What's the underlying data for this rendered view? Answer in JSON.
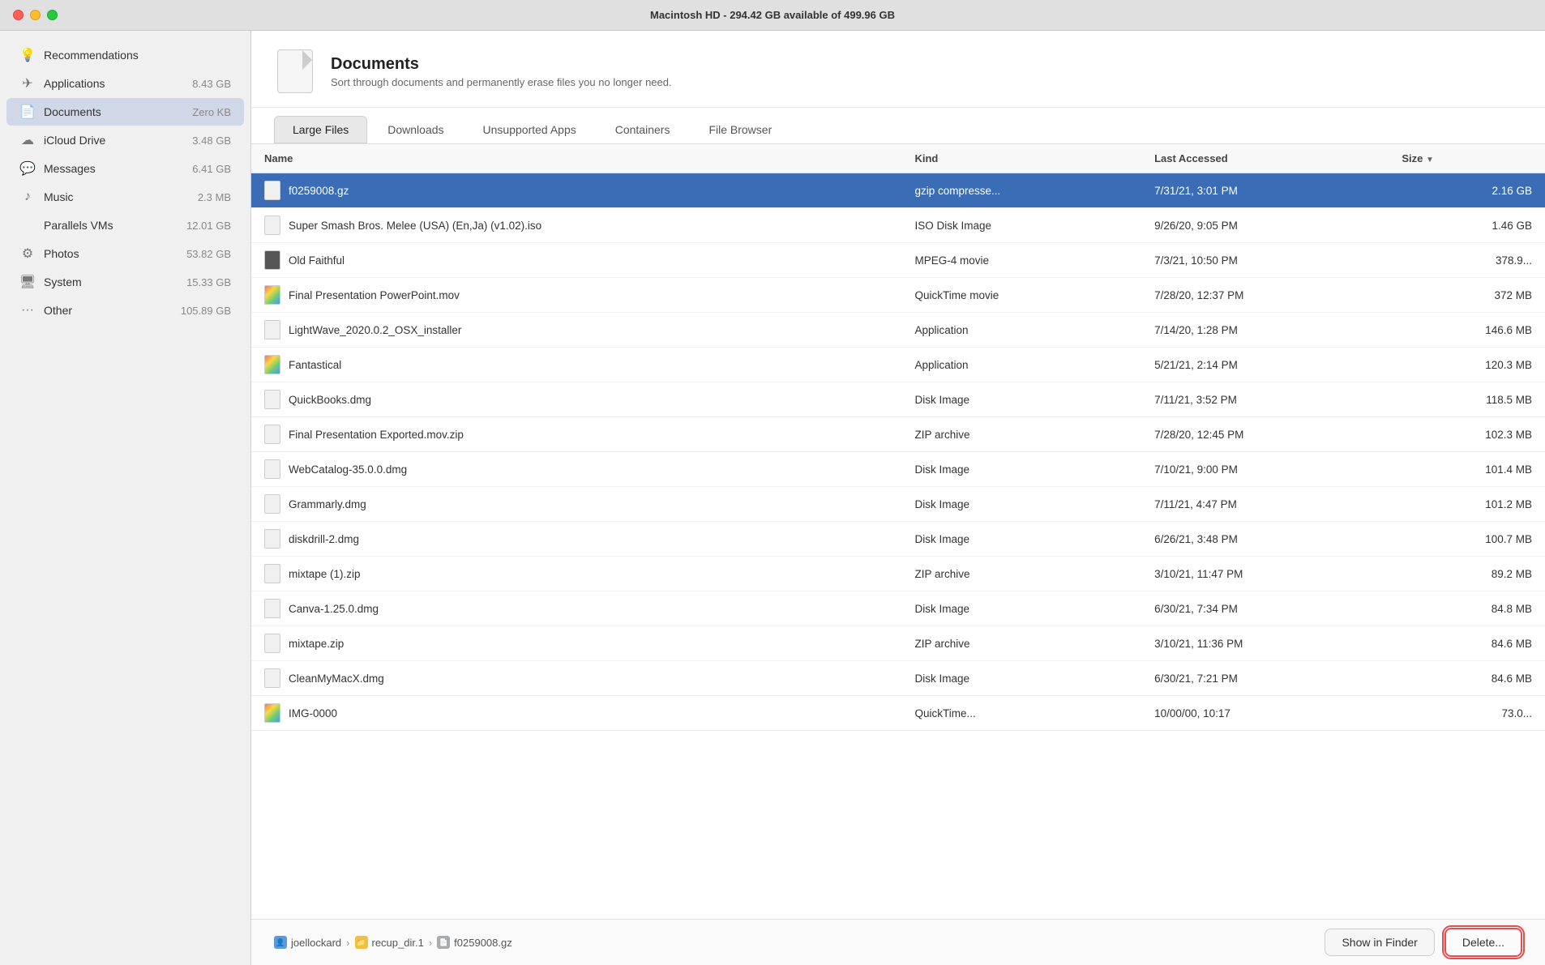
{
  "titlebar": {
    "title": "Macintosh HD - 294.42 GB available of 499.96 GB"
  },
  "sidebar": {
    "items": [
      {
        "id": "recommendations",
        "label": "Recommendations",
        "size": "",
        "icon": "💡",
        "active": false
      },
      {
        "id": "applications",
        "label": "Applications",
        "size": "8.43 GB",
        "icon": "✈",
        "active": false
      },
      {
        "id": "documents",
        "label": "Documents",
        "size": "Zero KB",
        "icon": "📄",
        "active": true
      },
      {
        "id": "icloud",
        "label": "iCloud Drive",
        "size": "3.48 GB",
        "icon": "☁",
        "active": false
      },
      {
        "id": "messages",
        "label": "Messages",
        "size": "6.41 GB",
        "icon": "💬",
        "active": false
      },
      {
        "id": "music",
        "label": "Music",
        "size": "2.3 MB",
        "icon": "♪",
        "active": false
      },
      {
        "id": "parallels",
        "label": "Parallels VMs",
        "size": "12.01 GB",
        "icon": "",
        "active": false
      },
      {
        "id": "photos",
        "label": "Photos",
        "size": "53.82 GB",
        "icon": "⚙",
        "active": false
      },
      {
        "id": "system",
        "label": "System",
        "size": "15.33 GB",
        "icon": "🖥",
        "active": false
      },
      {
        "id": "other",
        "label": "Other",
        "size": "105.89 GB",
        "icon": "···",
        "active": false
      }
    ]
  },
  "header": {
    "title": "Documents",
    "description": "Sort through documents and permanently erase files you no longer need."
  },
  "tabs": [
    {
      "id": "large-files",
      "label": "Large Files",
      "active": true
    },
    {
      "id": "downloads",
      "label": "Downloads",
      "active": false
    },
    {
      "id": "unsupported-apps",
      "label": "Unsupported Apps",
      "active": false
    },
    {
      "id": "containers",
      "label": "Containers",
      "active": false
    },
    {
      "id": "file-browser",
      "label": "File Browser",
      "active": false
    }
  ],
  "table": {
    "columns": [
      {
        "id": "name",
        "label": "Name"
      },
      {
        "id": "kind",
        "label": "Kind"
      },
      {
        "id": "last-accessed",
        "label": "Last Accessed"
      },
      {
        "id": "size",
        "label": "Size"
      }
    ],
    "rows": [
      {
        "selected": true,
        "name": "f0259008.gz",
        "kind": "gzip compresse...",
        "last_accessed": "7/31/21, 3:01 PM",
        "size": "2.16 GB",
        "icon_type": "file"
      },
      {
        "selected": false,
        "name": "Super Smash Bros. Melee (USA) (En,Ja) (v1.02).iso",
        "kind": "ISO Disk Image",
        "last_accessed": "9/26/20, 9:05 PM",
        "size": "1.46 GB",
        "icon_type": "file"
      },
      {
        "selected": false,
        "name": "Old Faithful",
        "kind": "MPEG-4 movie",
        "last_accessed": "7/3/21, 10:50 PM",
        "size": "378.9...",
        "icon_type": "dark"
      },
      {
        "selected": false,
        "name": "Final Presentation PowerPoint.mov",
        "kind": "QuickTime movie",
        "last_accessed": "7/28/20, 12:37 PM",
        "size": "372 MB",
        "icon_type": "rainbow"
      },
      {
        "selected": false,
        "name": "LightWave_2020.0.2_OSX_installer",
        "kind": "Application",
        "last_accessed": "7/14/20, 1:28 PM",
        "size": "146.6 MB",
        "icon_type": "file"
      },
      {
        "selected": false,
        "name": "Fantastical",
        "kind": "Application",
        "last_accessed": "5/21/21, 2:14 PM",
        "size": "120.3 MB",
        "icon_type": "rainbow"
      },
      {
        "selected": false,
        "name": "QuickBooks.dmg",
        "kind": "Disk Image",
        "last_accessed": "7/11/21, 3:52 PM",
        "size": "118.5 MB",
        "icon_type": "file"
      },
      {
        "selected": false,
        "name": "Final Presentation Exported.mov.zip",
        "kind": "ZIP archive",
        "last_accessed": "7/28/20, 12:45 PM",
        "size": "102.3 MB",
        "icon_type": "file"
      },
      {
        "selected": false,
        "name": "WebCatalog-35.0.0.dmg",
        "kind": "Disk Image",
        "last_accessed": "7/10/21, 9:00 PM",
        "size": "101.4 MB",
        "icon_type": "file"
      },
      {
        "selected": false,
        "name": "Grammarly.dmg",
        "kind": "Disk Image",
        "last_accessed": "7/11/21, 4:47 PM",
        "size": "101.2 MB",
        "icon_type": "file"
      },
      {
        "selected": false,
        "name": "diskdrill-2.dmg",
        "kind": "Disk Image",
        "last_accessed": "6/26/21, 3:48 PM",
        "size": "100.7 MB",
        "icon_type": "file"
      },
      {
        "selected": false,
        "name": "mixtape (1).zip",
        "kind": "ZIP archive",
        "last_accessed": "3/10/21, 11:47 PM",
        "size": "89.2 MB",
        "icon_type": "file"
      },
      {
        "selected": false,
        "name": "Canva-1.25.0.dmg",
        "kind": "Disk Image",
        "last_accessed": "6/30/21, 7:34 PM",
        "size": "84.8 MB",
        "icon_type": "file"
      },
      {
        "selected": false,
        "name": "mixtape.zip",
        "kind": "ZIP archive",
        "last_accessed": "3/10/21, 11:36 PM",
        "size": "84.6 MB",
        "icon_type": "file"
      },
      {
        "selected": false,
        "name": "CleanMyMacX.dmg",
        "kind": "Disk Image",
        "last_accessed": "6/30/21, 7:21 PM",
        "size": "84.6 MB",
        "icon_type": "file"
      },
      {
        "selected": false,
        "name": "IMG-0000",
        "kind": "QuickTime...",
        "last_accessed": "10/00/00, 10:17",
        "size": "73.0...",
        "icon_type": "rainbow"
      }
    ]
  },
  "breadcrumb": {
    "items": [
      {
        "label": "joellockard",
        "icon": "user"
      },
      {
        "label": "recup_dir.1",
        "icon": "folder"
      },
      {
        "label": "f0259008.gz",
        "icon": "file"
      }
    ]
  },
  "actions": {
    "show_in_finder": "Show in Finder",
    "delete": "Delete..."
  },
  "colors": {
    "selected_row_bg": "#3a6db5",
    "delete_border": "#e05050",
    "active_tab_bg": "#e8e8e8"
  }
}
